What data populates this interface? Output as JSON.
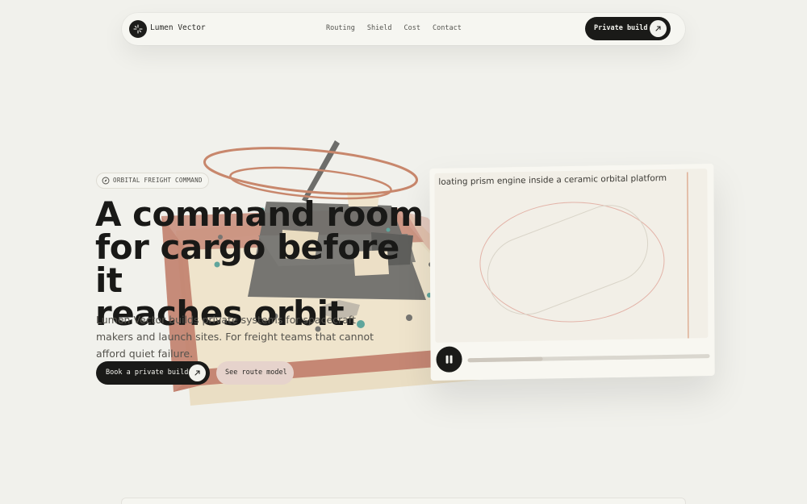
{
  "nav": {
    "brand": "Lumen Vector",
    "links": [
      "Routing",
      "Shield",
      "Cost",
      "Contact"
    ],
    "cta": "Private build"
  },
  "hero": {
    "eyebrow": "ORBITAL FREIGHT COMMAND",
    "title_lines": [
      "A command room",
      "for cargo before it",
      "reaches orbit."
    ],
    "subtitle": "Lumen Vector builds private systems for spacecraft makers and launch sites. For freight teams that cannot afford quiet failure.",
    "primary_cta": "Book a private build",
    "secondary_cta": "See route model"
  },
  "panel": {
    "caption": "loating prism engine inside a ceramic orbital platform",
    "progress": 0.31
  },
  "icons": {
    "logo": "sparkle-icon",
    "cta_arrow": "arrow-up-right-icon",
    "eyebrow": "compass-icon",
    "player": "pause-icon"
  },
  "colors": {
    "background": "#f1f1ec",
    "ink": "#1a1a18",
    "terracotta": "#c4806f",
    "sand": "#e8d9bc",
    "teal": "#5fa59c"
  }
}
